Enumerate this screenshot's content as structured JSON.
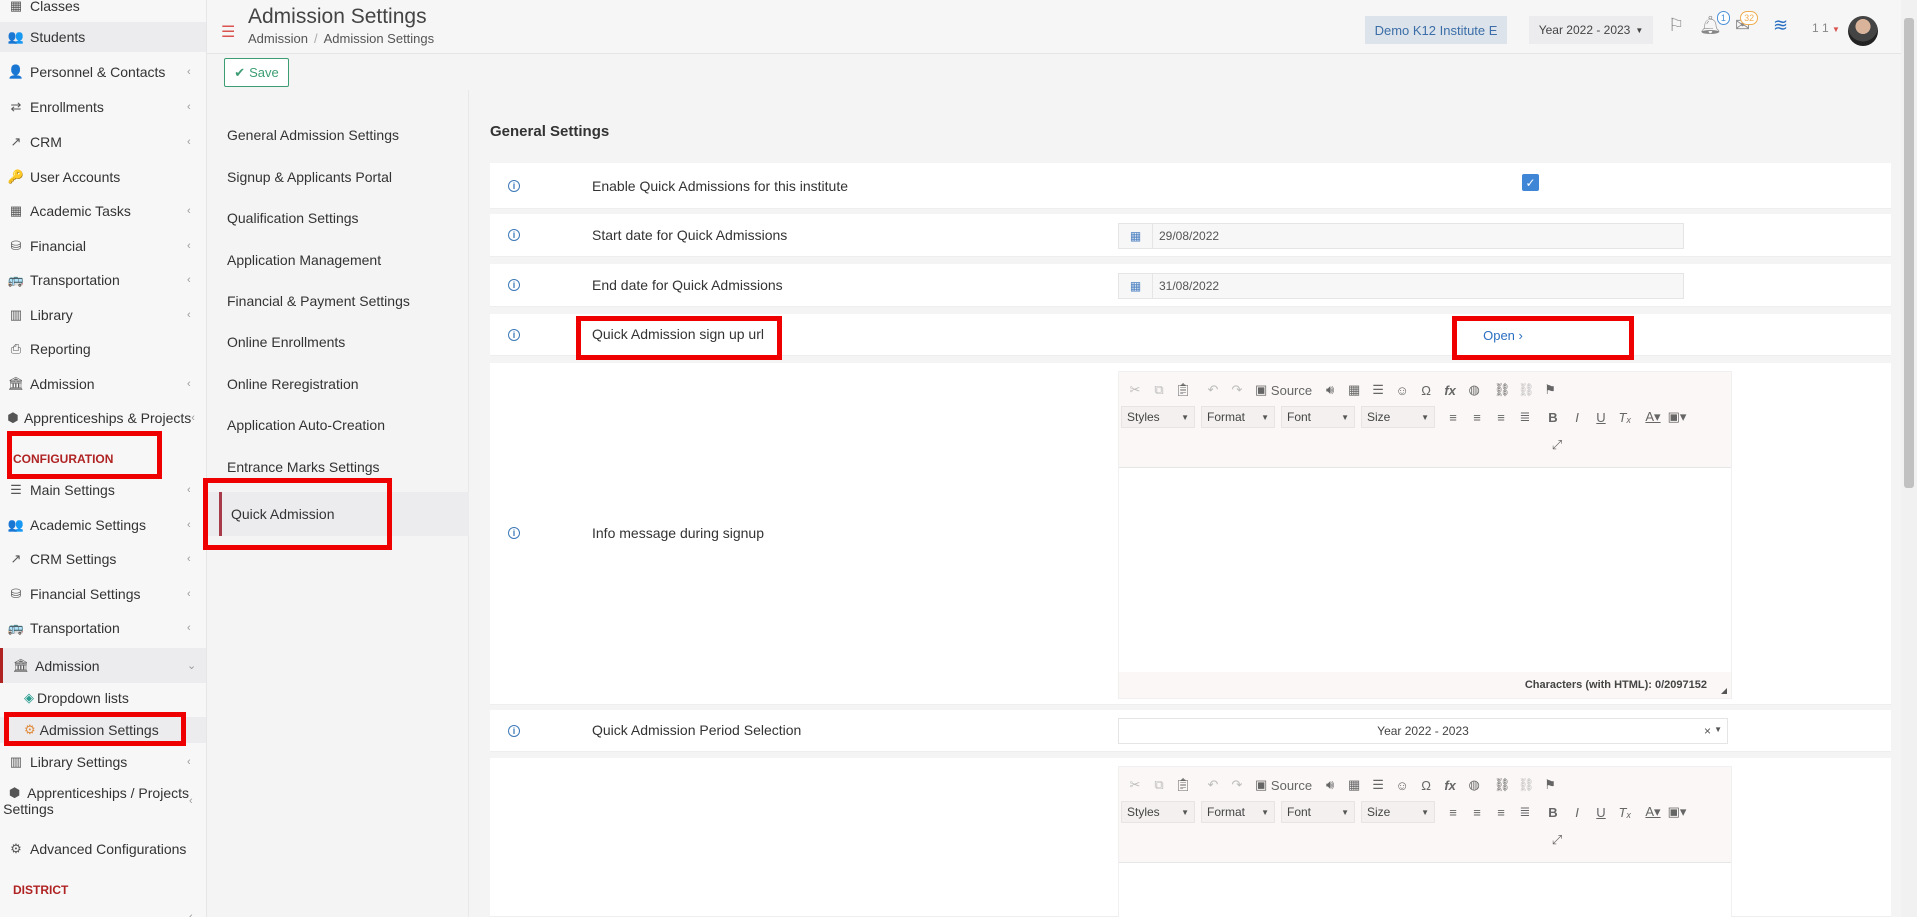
{
  "sidebar": {
    "items": [
      {
        "label": "Classes",
        "icon": "classes-icon"
      },
      {
        "label": "Students",
        "icon": "students-icon"
      },
      {
        "label": "Personnel & Contacts",
        "icon": "personnel-icon"
      },
      {
        "label": "Enrollments",
        "icon": "enrollments-icon"
      },
      {
        "label": "CRM",
        "icon": "crm-icon"
      },
      {
        "label": "User Accounts",
        "icon": "key-icon"
      },
      {
        "label": "Academic Tasks",
        "icon": "grid-icon"
      },
      {
        "label": "Financial",
        "icon": "coins-icon"
      },
      {
        "label": "Transportation",
        "icon": "bus-icon"
      },
      {
        "label": "Library",
        "icon": "books-icon"
      },
      {
        "label": "Reporting",
        "icon": "printer-icon"
      },
      {
        "label": "Admission",
        "icon": "bank-icon"
      },
      {
        "label": "Apprenticeships & Projects",
        "icon": "cube-icon"
      }
    ],
    "config_heading": "CONFIGURATION",
    "config_items": [
      {
        "label": "Main Settings",
        "icon": "sliders-icon"
      },
      {
        "label": "Academic Settings",
        "icon": "students-icon"
      },
      {
        "label": "CRM Settings",
        "icon": "crm-icon"
      },
      {
        "label": "Financial Settings",
        "icon": "coins-icon"
      },
      {
        "label": "Transportation",
        "icon": "bus-icon"
      },
      {
        "label": "Admission",
        "icon": "bank-icon"
      }
    ],
    "admission_sub": {
      "dropdown_lists": "Dropdown lists",
      "admission_settings": "Admission Settings"
    },
    "after_items": [
      {
        "label": "Library Settings",
        "icon": "books-icon"
      },
      {
        "label": "Apprenticeships / Projects",
        "label2": "Settings",
        "icon": "cube-icon"
      },
      {
        "label": "Advanced Configurations",
        "icon": "gears-icon"
      }
    ],
    "district_heading": "DISTRICT"
  },
  "topbar": {
    "title": "Admission Settings",
    "breadcrumb": [
      "Admission",
      "Admission Settings"
    ],
    "institute": "Demo K12 Institute E",
    "year": "Year 2022 - 2023",
    "notifications_count": "1",
    "messages_count": "32",
    "user_code": "1 1"
  },
  "toolbar": {
    "save_label": "Save"
  },
  "settings_nav": {
    "items": [
      "General Admission Settings",
      "Signup & Applicants Portal",
      "Qualification Settings",
      "Application Management",
      "Financial & Payment Settings",
      "Online Enrollments",
      "Online Reregistration",
      "Application Auto-Creation",
      "Entrance Marks Settings",
      "Quick Admission"
    ]
  },
  "main": {
    "section_title": "General Settings",
    "enable_label": "Enable Quick Admissions for this institute",
    "start_label": "Start date for Quick Admissions",
    "start_value": "29/08/2022",
    "end_label": "End date for Quick Admissions",
    "end_value": "31/08/2022",
    "signup_url_label": "Quick Admission sign up url",
    "open_label": "Open",
    "info_message_label": "Info message during signup",
    "char_count": "Characters (with HTML): 0/2097152",
    "period_label": "Quick Admission Period Selection",
    "period_value": "Year 2022 - 2023",
    "editor": {
      "source_label": "Source",
      "styles": "Styles",
      "format": "Format",
      "font": "Font",
      "size": "Size"
    }
  },
  "colors": {
    "accent_red": "#ee0000",
    "save_green": "#3c9d72",
    "link_blue": "#2a6fc1",
    "checkbox_blue": "#3f87d6"
  }
}
